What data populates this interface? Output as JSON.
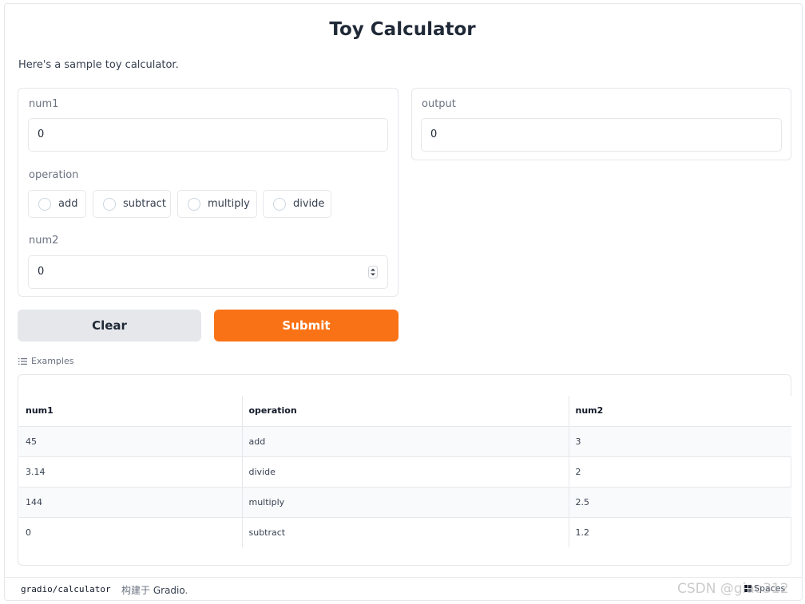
{
  "app": {
    "title": "Toy Calculator",
    "description": "Here's a sample toy calculator."
  },
  "inputs": {
    "num1": {
      "label": "num1",
      "value": "0"
    },
    "operation": {
      "label": "operation",
      "options": [
        "add",
        "subtract",
        "multiply",
        "divide"
      ],
      "selected": null
    },
    "num2": {
      "label": "num2",
      "value": "0"
    }
  },
  "output": {
    "label": "output",
    "value": "0"
  },
  "buttons": {
    "clear": "Clear",
    "submit": "Submit"
  },
  "examples": {
    "label": "Examples",
    "columns": [
      "num1",
      "operation",
      "num2"
    ],
    "rows": [
      [
        "45",
        "add",
        "3"
      ],
      [
        "3.14",
        "divide",
        "2"
      ],
      [
        "144",
        "multiply",
        "2.5"
      ],
      [
        "0",
        "subtract",
        "1.2"
      ]
    ]
  },
  "footer": {
    "repo": "gradio/calculator",
    "built_with": "构建于",
    "gradio": "Gradio",
    "spaces": "Spaces",
    "watermark": "CSDN @giao312"
  },
  "colors": {
    "accent": "#f97316",
    "clear_bg": "#e5e7eb",
    "border": "#e5e7eb"
  },
  "icons": {
    "examples": "list-icon",
    "number_spinner": "spinner-arrows-icon",
    "spaces": "spaces-logo-icon"
  }
}
